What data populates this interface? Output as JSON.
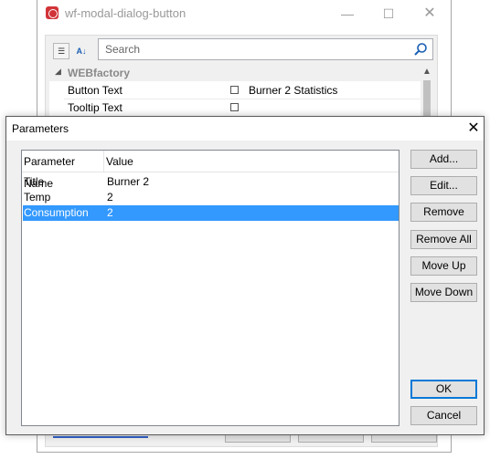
{
  "background_window": {
    "title": "wf-modal-dialog-button",
    "search": {
      "placeholder": "Search"
    },
    "category": "WEBfactory",
    "properties": [
      {
        "name": "Button Text",
        "value": "Burner 2 Statistics"
      },
      {
        "name": "Tooltip Text",
        "value": ""
      }
    ]
  },
  "dialog": {
    "title": "Parameters",
    "columns": [
      "Parameter Name",
      "Value"
    ],
    "rows": [
      {
        "name": "Title",
        "value": "Burner 2",
        "selected": false
      },
      {
        "name": "Temp",
        "value": "2",
        "selected": false
      },
      {
        "name": "Consumption",
        "value": "2",
        "selected": true
      }
    ],
    "buttons": {
      "add": "Add...",
      "edit": "Edit...",
      "remove": "Remove",
      "remove_all": "Remove All",
      "move_up": "Move Up",
      "move_down": "Move Down",
      "ok": "OK",
      "cancel": "Cancel"
    }
  },
  "icons": {
    "app": "app-icon",
    "minimize": "minimize-icon",
    "maximize": "maximize-icon",
    "close": "close-icon",
    "search": "search-icon",
    "categorized": "categorized-view-icon",
    "alphabetical": "alphabetical-sort-icon"
  },
  "colors": {
    "selection": "#3399ff",
    "default_button_border": "#0078d7",
    "app_icon": "#d13438"
  }
}
